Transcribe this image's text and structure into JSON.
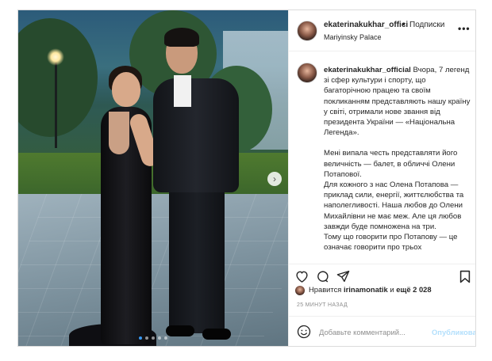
{
  "post": {
    "username": "ekaterinakukhar_offici",
    "separator": "•",
    "follow_label": "Подписки",
    "location": "Mariyinsky Palace",
    "more_icon": "more-horizontal-icon"
  },
  "caption": {
    "username": "ekaterinakukhar_official",
    "lines_intro": "Вчора, 7 легенд зі сфер культури і спорту, що багаторічною працею та своїм покликанням представляють нашу країну у світі, отримали нове звання від президента України — «Національна Легенда».",
    "para2_l1": "Мені випала честь представляти його величність — балет, в обличчі Олени Потапової.",
    "para3": "Для кожного з нас Олена Потапова — приклад сили, енергії, життєлюбства та наполегливості. Наша любов до Олени Михайлівни не має меж. Але ця любов завжди буде помножена на три.",
    "para4": "Тому що говорити про Потапову — це означає говорити про трьох"
  },
  "actions": {
    "like_icon": "heart-icon",
    "comment_icon": "comment-icon",
    "share_icon": "send-icon",
    "save_icon": "bookmark-icon"
  },
  "likes": {
    "prefix": "Нравится",
    "user": "irinamonatik",
    "mid": "и",
    "count": "ещё 2 028"
  },
  "timestamp": "25 МИНУТ НАЗАД",
  "comment": {
    "placeholder": "Добавьте комментарий...",
    "post_label": "Опубликовать",
    "emoji_icon": "emoji-icon"
  },
  "carousel": {
    "next_icon": "chevron-right-icon",
    "total": 5,
    "active": 1
  },
  "colors": {
    "border": "#dbdbdb",
    "link_disabled": "#b2dffc",
    "active_dot": "#3897f0",
    "muted": "#8e8e8e"
  }
}
